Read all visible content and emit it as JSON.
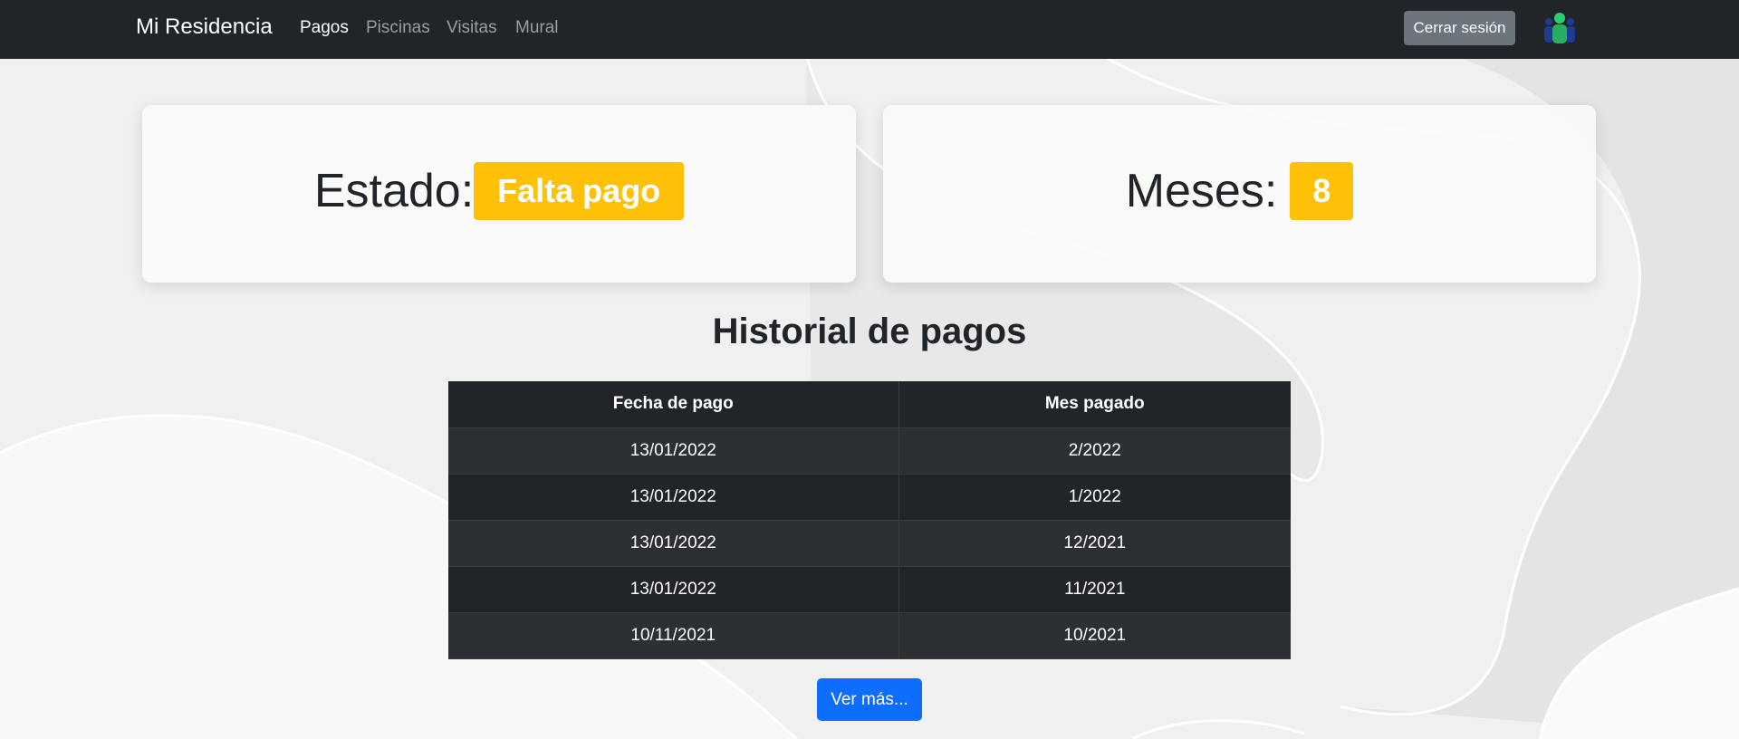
{
  "navbar": {
    "brand": "Mi Residencia",
    "links": [
      "Pagos",
      "Piscinas",
      "Visitas",
      "Mural"
    ],
    "logout_label": "Cerrar sesión",
    "avatar_icon": "user-group-icon"
  },
  "status_card": {
    "label": "Estado:",
    "badge": "Falta pago"
  },
  "months_card": {
    "label": "Meses:",
    "badge": "8"
  },
  "history": {
    "title": "Historial de pagos",
    "headers": [
      "Fecha de pago",
      "Mes pagado"
    ],
    "rows": [
      [
        "13/01/2022",
        "2/2022"
      ],
      [
        "13/01/2022",
        "1/2022"
      ],
      [
        "13/01/2022",
        "12/2021"
      ],
      [
        "13/01/2022",
        "11/2021"
      ],
      [
        "10/11/2021",
        "10/2021"
      ]
    ],
    "more_label": "Ver más..."
  },
  "colors": {
    "navbar_bg": "#212529",
    "warning": "#ffc107",
    "primary": "#0d6efd",
    "secondary": "#6c757d",
    "table_dark": "#212529",
    "table_striped": "#2c3034"
  }
}
